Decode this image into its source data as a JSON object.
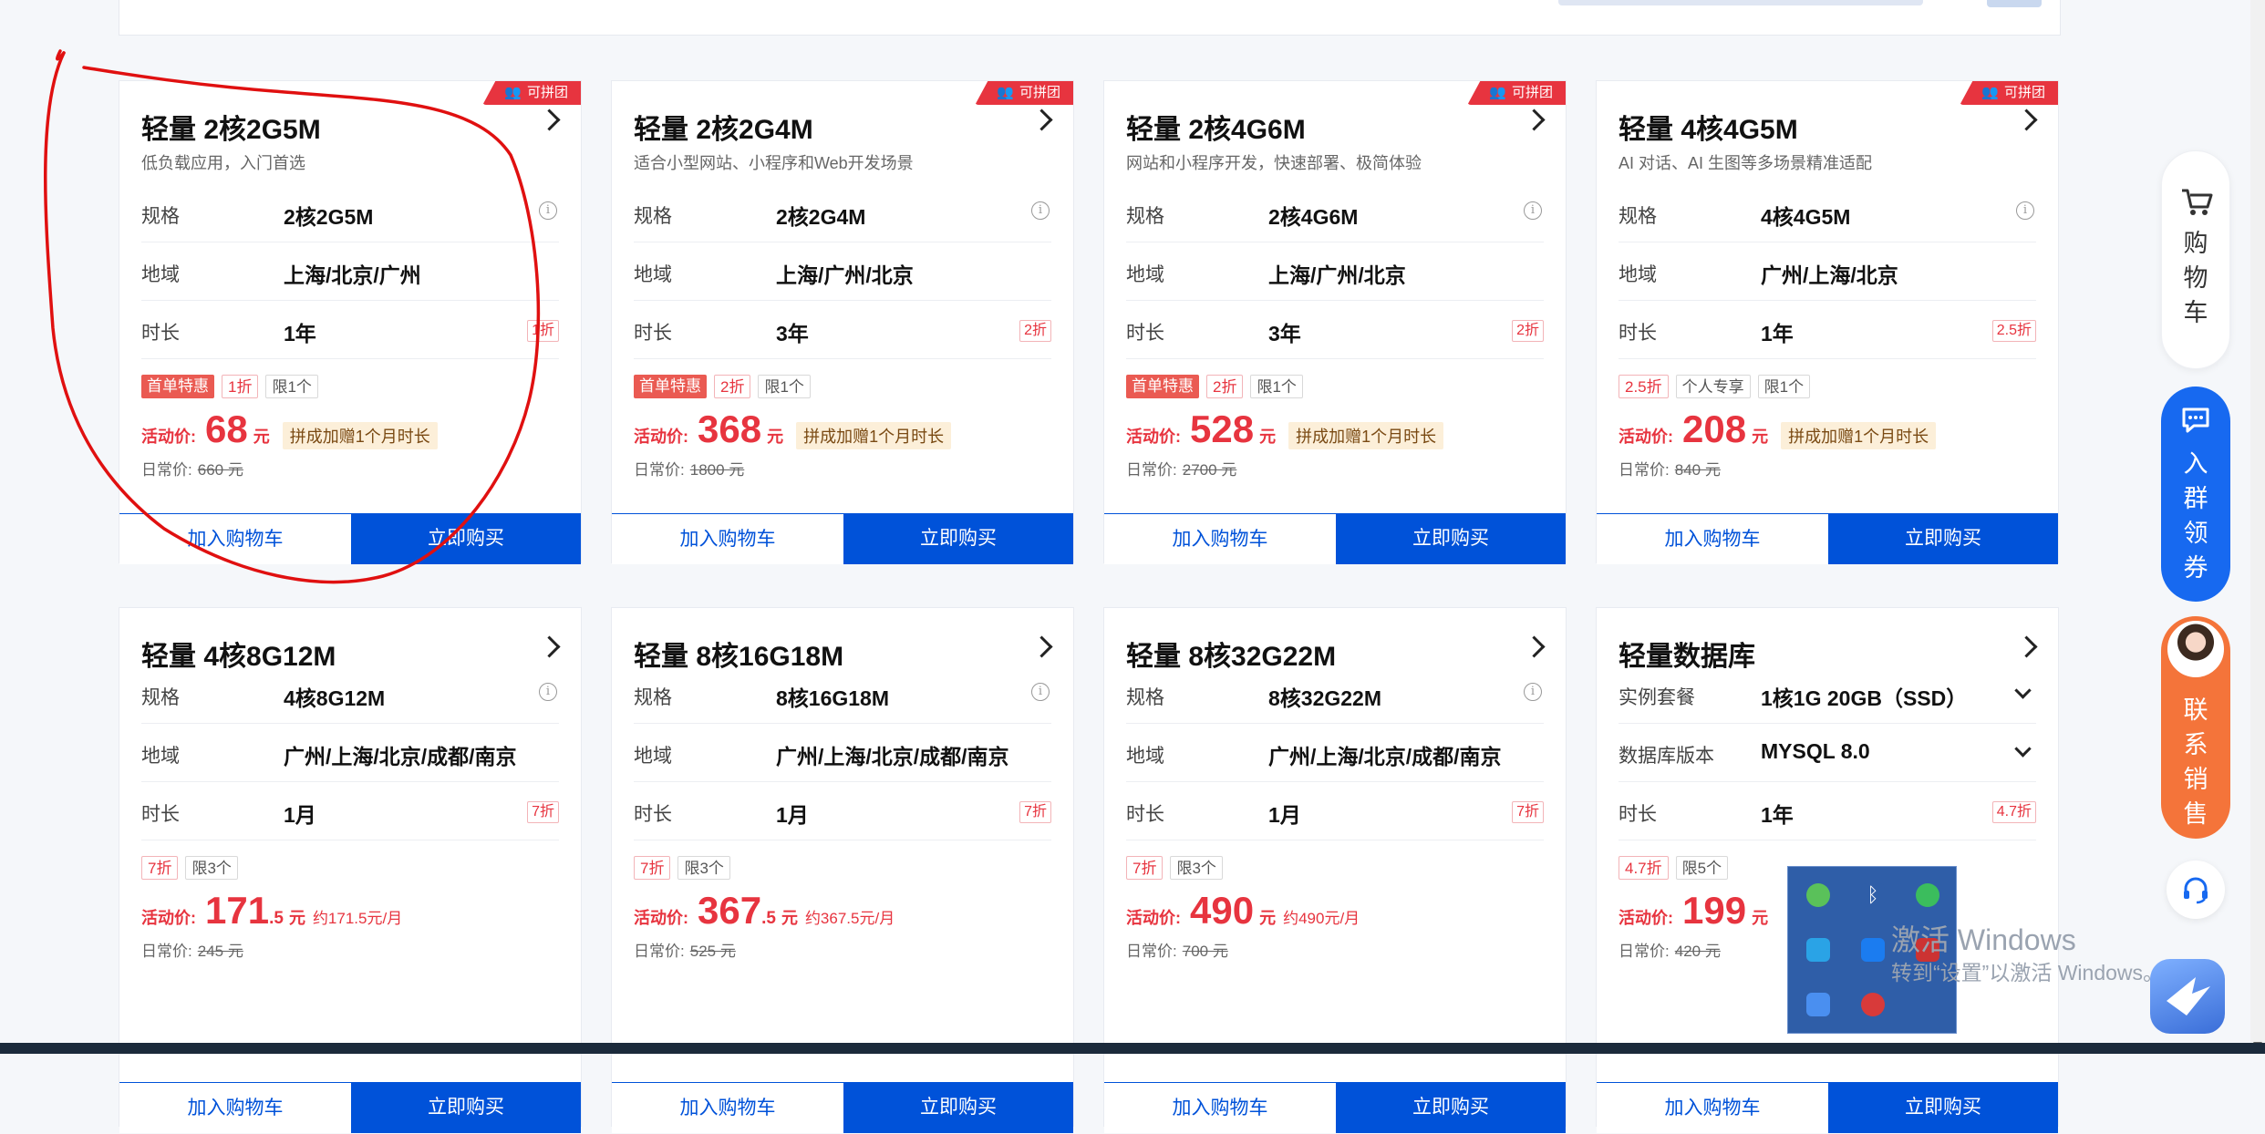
{
  "cards_row1": [
    {
      "title": "轻量 2核2G5M",
      "subtitle": "低负载应用，入门首选",
      "corner_tag": "可拼团",
      "specs": [
        {
          "label": "规格",
          "value": "2核2G5M",
          "extra": "info"
        },
        {
          "label": "地域",
          "value": "上海/北京/广州",
          "extra": ""
        },
        {
          "label": "时长",
          "value": "1年",
          "extra": "1折"
        }
      ],
      "badges": [
        {
          "text": "首单特惠",
          "kind": "hot"
        },
        {
          "text": "1折",
          "kind": "red"
        },
        {
          "text": "限1个",
          "kind": "gray"
        }
      ],
      "price_label": "活动价:",
      "price_int": "68",
      "price_dec": "",
      "price_unit": "元",
      "price_note": "",
      "gift": "拼成加赠1个月时长",
      "orig_label": "日常价:",
      "orig_value": "660 元",
      "add_cart": "加入购物车",
      "buy_now": "立即购买"
    },
    {
      "title": "轻量 2核2G4M",
      "subtitle": "适合小型网站、小程序和Web开发场景",
      "corner_tag": "可拼团",
      "specs": [
        {
          "label": "规格",
          "value": "2核2G4M",
          "extra": "info"
        },
        {
          "label": "地域",
          "value": "上海/广州/北京",
          "extra": ""
        },
        {
          "label": "时长",
          "value": "3年",
          "extra": "2折"
        }
      ],
      "badges": [
        {
          "text": "首单特惠",
          "kind": "hot"
        },
        {
          "text": "2折",
          "kind": "red"
        },
        {
          "text": "限1个",
          "kind": "gray"
        }
      ],
      "price_label": "活动价:",
      "price_int": "368",
      "price_dec": "",
      "price_unit": "元",
      "price_note": "",
      "gift": "拼成加赠1个月时长",
      "orig_label": "日常价:",
      "orig_value": "1800 元",
      "add_cart": "加入购物车",
      "buy_now": "立即购买"
    },
    {
      "title": "轻量 2核4G6M",
      "subtitle": "网站和小程序开发，快速部署、极简体验",
      "corner_tag": "可拼团",
      "specs": [
        {
          "label": "规格",
          "value": "2核4G6M",
          "extra": "info"
        },
        {
          "label": "地域",
          "value": "上海/广州/北京",
          "extra": ""
        },
        {
          "label": "时长",
          "value": "3年",
          "extra": "2折"
        }
      ],
      "badges": [
        {
          "text": "首单特惠",
          "kind": "hot"
        },
        {
          "text": "2折",
          "kind": "red"
        },
        {
          "text": "限1个",
          "kind": "gray"
        }
      ],
      "price_label": "活动价:",
      "price_int": "528",
      "price_dec": "",
      "price_unit": "元",
      "price_note": "",
      "gift": "拼成加赠1个月时长",
      "orig_label": "日常价:",
      "orig_value": "2700 元",
      "add_cart": "加入购物车",
      "buy_now": "立即购买"
    },
    {
      "title": "轻量 4核4G5M",
      "subtitle": "AI 对话、AI 生图等多场景精准适配",
      "corner_tag": "可拼团",
      "specs": [
        {
          "label": "规格",
          "value": "4核4G5M",
          "extra": "info"
        },
        {
          "label": "地域",
          "value": "广州/上海/北京",
          "extra": ""
        },
        {
          "label": "时长",
          "value": "1年",
          "extra": "2.5折"
        }
      ],
      "badges": [
        {
          "text": "2.5折",
          "kind": "red"
        },
        {
          "text": "个人专享",
          "kind": "gray"
        },
        {
          "text": "限1个",
          "kind": "gray"
        }
      ],
      "price_label": "活动价:",
      "price_int": "208",
      "price_dec": "",
      "price_unit": "元",
      "price_note": "",
      "gift": "拼成加赠1个月时长",
      "orig_label": "日常价:",
      "orig_value": "840 元",
      "add_cart": "加入购物车",
      "buy_now": "立即购买"
    }
  ],
  "cards_row2": [
    {
      "title": "轻量 4核8G12M",
      "specs": [
        {
          "label": "规格",
          "value": "4核8G12M",
          "extra": "info"
        },
        {
          "label": "地域",
          "value": "广州/上海/北京/成都/南京",
          "extra": ""
        },
        {
          "label": "时长",
          "value": "1月",
          "extra": "7折"
        }
      ],
      "badges": [
        {
          "text": "7折",
          "kind": "red"
        },
        {
          "text": "限3个",
          "kind": "gray"
        }
      ],
      "price_label": "活动价:",
      "price_int": "171",
      "price_dec": ".5",
      "price_unit": "元",
      "price_note": "约171.5元/月",
      "orig_label": "日常价:",
      "orig_value": "245 元",
      "add_cart": "加入购物车",
      "buy_now": "立即购买"
    },
    {
      "title": "轻量 8核16G18M",
      "specs": [
        {
          "label": "规格",
          "value": "8核16G18M",
          "extra": "info"
        },
        {
          "label": "地域",
          "value": "广州/上海/北京/成都/南京",
          "extra": ""
        },
        {
          "label": "时长",
          "value": "1月",
          "extra": "7折"
        }
      ],
      "badges": [
        {
          "text": "7折",
          "kind": "red"
        },
        {
          "text": "限3个",
          "kind": "gray"
        }
      ],
      "price_label": "活动价:",
      "price_int": "367",
      "price_dec": ".5",
      "price_unit": "元",
      "price_note": "约367.5元/月",
      "orig_label": "日常价:",
      "orig_value": "525 元",
      "add_cart": "加入购物车",
      "buy_now": "立即购买"
    },
    {
      "title": "轻量 8核32G22M",
      "specs": [
        {
          "label": "规格",
          "value": "8核32G22M",
          "extra": "info"
        },
        {
          "label": "地域",
          "value": "广州/上海/北京/成都/南京",
          "extra": ""
        },
        {
          "label": "时长",
          "value": "1月",
          "extra": "7折"
        }
      ],
      "badges": [
        {
          "text": "7折",
          "kind": "red"
        },
        {
          "text": "限3个",
          "kind": "gray"
        }
      ],
      "price_label": "活动价:",
      "price_int": "490",
      "price_dec": "",
      "price_unit": "元",
      "price_note": "约490元/月",
      "orig_label": "日常价:",
      "orig_value": "700 元",
      "add_cart": "加入购物车",
      "buy_now": "立即购买"
    },
    {
      "title": "轻量数据库",
      "specs": [
        {
          "label": "实例套餐",
          "value": "1核1G 20GB（SSD）",
          "extra": "dropdown"
        },
        {
          "label": "数据库版本",
          "value": "MYSQL 8.0",
          "extra": "dropdown"
        },
        {
          "label": "时长",
          "value": "1年",
          "extra": "4.7折"
        }
      ],
      "badges": [
        {
          "text": "4.7折",
          "kind": "red"
        },
        {
          "text": "限5个",
          "kind": "gray"
        }
      ],
      "price_label": "活动价:",
      "price_int": "199",
      "price_dec": "",
      "price_unit": "元",
      "price_note": "",
      "orig_label": "日常价:",
      "orig_value": "420 元",
      "add_cart": "加入购物车",
      "buy_now": "立即购买"
    }
  ],
  "float_panel": {
    "cart_label": "购物车",
    "group_label": "入群领券",
    "sales_label": "联系销售"
  },
  "watermark": {
    "line1": "激活 Windows",
    "line2": "转到“设置”以激活 Windows。"
  },
  "colors": {
    "primary": "#0052d9",
    "price_red": "#e7343f",
    "group_blue": "#1769f0",
    "sales_orange": "#f4743a",
    "annotation_red": "#e01010"
  }
}
